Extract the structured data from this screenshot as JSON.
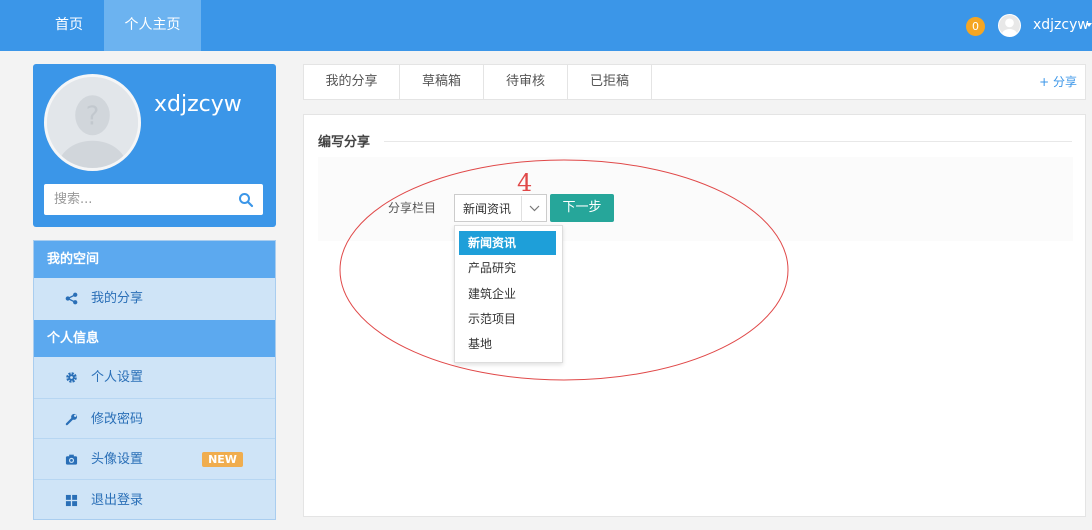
{
  "topnav": {
    "home": "首页",
    "profile": "个人主页",
    "badge_count": "0",
    "username": "xdjzcyw"
  },
  "profile": {
    "name": "xdjzcyw",
    "search_placeholder": "搜索..."
  },
  "sidebar": {
    "section_space": "我的空间",
    "my_share": "我的分享",
    "section_info": "个人信息",
    "settings": "个人设置",
    "password": "修改密码",
    "avatar": "头像设置",
    "new_badge": "NEW",
    "logout": "退出登录"
  },
  "tabs": {
    "items": [
      "我的分享",
      "草稿箱",
      "待审核",
      "已拒稿"
    ],
    "add": "+ 分享"
  },
  "form": {
    "title": "编写分享",
    "category_label": "分享栏目",
    "selected": "新闻资讯",
    "next": "下一步",
    "options": [
      "新闻资讯",
      "产品研究",
      "建筑企业",
      "示范项目",
      "基地"
    ]
  },
  "annotation": {
    "number": "4",
    "color": "#e04848"
  },
  "colors": {
    "primary": "#3b96e8",
    "teal": "#26a69a",
    "selected_option": "#1e9fd9",
    "badge": "#f5a623"
  }
}
